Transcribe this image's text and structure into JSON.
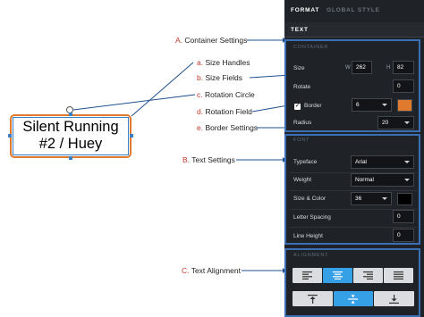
{
  "callouts": {
    "container": {
      "key": "A.",
      "text": " Container Settings"
    },
    "size_handles": {
      "key": "a.",
      "text": " Size Handles"
    },
    "size_fields": {
      "key": "b.",
      "text": " Size Fields"
    },
    "rotation_circle": {
      "key": "c.",
      "text": " Rotation Circle"
    },
    "rotation_field": {
      "key": "d.",
      "text": " Rotation Field"
    },
    "border_settings": {
      "key": "e.",
      "text": " Border Settings"
    },
    "text_settings": {
      "key": "B.",
      "text": " Text Settings"
    },
    "text_alignment": {
      "key": "C.",
      "text": " Text Alignment"
    }
  },
  "canvas": {
    "text_line_1": "Silent Running",
    "text_line_2": "#2 / Huey",
    "border_color": "#e07a2e",
    "selection_color": "#3b7fc4"
  },
  "panel": {
    "tabs": [
      "FORMAT",
      "GLOBAL STYLE"
    ],
    "section_title": "TEXT",
    "container": {
      "group_label": "CONTAINER",
      "size_label": "Size",
      "w_label": "W",
      "w_value": "262",
      "h_label": "H",
      "h_value": "82",
      "rotate_label": "Rotate",
      "rotate_value": "0",
      "border_label": "Border",
      "border_checked": true,
      "border_width": "6",
      "border_color": "#e07a2e",
      "radius_label": "Radius",
      "radius_value": "20"
    },
    "font": {
      "group_label": "FONT",
      "typeface_label": "Typeface",
      "typeface_value": "Arial",
      "weight_label": "Weight",
      "weight_value": "Normal",
      "size_color_label": "Size & Color",
      "size_value": "36",
      "color": "#000000",
      "letter_spacing_label": "Letter Spacing",
      "letter_spacing_value": "0",
      "line_height_label": "Line Height",
      "line_height_value": "0"
    },
    "alignment": {
      "group_label": "ALIGNMENT",
      "horizontal": [
        "align-left",
        "align-center",
        "align-right",
        "align-justify"
      ],
      "horizontal_active": "align-center",
      "vertical": [
        "align-top",
        "align-middle",
        "align-bottom"
      ],
      "vertical_active": "align-middle",
      "accent": "#36a0e6"
    }
  }
}
